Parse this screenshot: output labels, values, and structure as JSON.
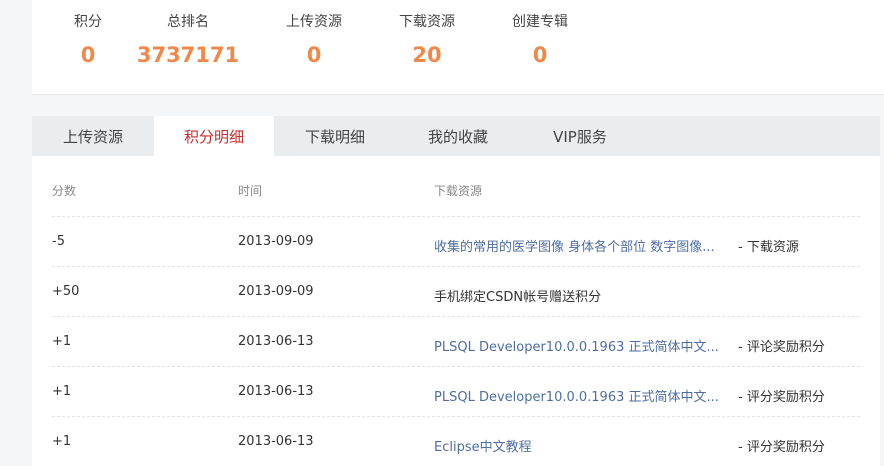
{
  "stats": [
    {
      "label": "积分",
      "value": "0"
    },
    {
      "label": "总排名",
      "value": "3737171"
    },
    {
      "label": "上传资源",
      "value": "0"
    },
    {
      "label": "下载资源",
      "value": "20"
    },
    {
      "label": "创建专辑",
      "value": "0"
    }
  ],
  "tabs": [
    {
      "label": "上传资源",
      "active": false
    },
    {
      "label": "积分明细",
      "active": true
    },
    {
      "label": "下载明细",
      "active": false
    },
    {
      "label": "我的收藏",
      "active": false
    },
    {
      "label": "VIP服务",
      "active": false
    }
  ],
  "table": {
    "headers": {
      "score": "分数",
      "time": "时间",
      "resource": "下载资源"
    },
    "rows": [
      {
        "score": "-5",
        "time": "2013-09-09",
        "resource": "收集的常用的医学图像 身体各个部位 数字图像...",
        "type": "- 下载资源",
        "linked": true
      },
      {
        "score": "+50",
        "time": "2013-09-09",
        "resource": "手机绑定CSDN帐号赠送积分",
        "type": "",
        "linked": false
      },
      {
        "score": "+1",
        "time": "2013-06-13",
        "resource": "PLSQL Developer10.0.0.1963 正式简体中文...",
        "type": "- 评论奖励积分",
        "linked": true
      },
      {
        "score": "+1",
        "time": "2013-06-13",
        "resource": "PLSQL Developer10.0.0.1963 正式简体中文...",
        "type": "- 评分奖励积分",
        "linked": true
      },
      {
        "score": "+1",
        "time": "2013-06-13",
        "resource": "Eclipse中文教程",
        "type": "- 评分奖励积分",
        "linked": true
      }
    ]
  },
  "colors": {
    "accent_orange": "#f0884a",
    "active_tab_red": "#ca2c2c",
    "link_blue": "#4f6ea0"
  }
}
